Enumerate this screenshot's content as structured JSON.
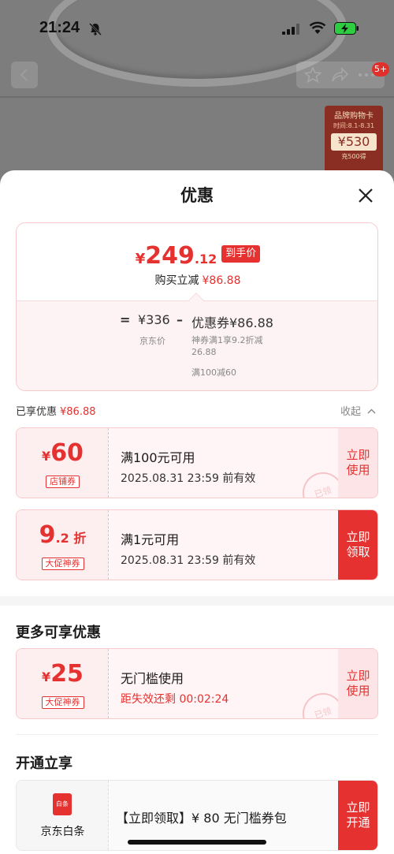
{
  "status_bar": {
    "time": "21:24"
  },
  "background": {
    "message_badge": "5+",
    "brand_card": {
      "title": "品牌购物卡",
      "time": "时间:8.1-8.31",
      "amount": "¥530",
      "condition": "充500得"
    }
  },
  "sheet": {
    "title": "优惠",
    "summary": {
      "price_yen": "¥",
      "price_int": "249",
      "price_dec": ".12",
      "price_tag": "到手价",
      "saving_label": "购买立减",
      "saving_amount": "¥86.88",
      "formula": {
        "eq": "=",
        "jd_price": "¥336",
        "minus": "–",
        "coupon_total": "优惠券¥86.88",
        "jd_label": "京东价",
        "coupon_detail1": "神券满1享9.2折减26.88",
        "coupon_detail2": "满100减60"
      }
    },
    "enjoyed": {
      "label": "已享优惠",
      "amount": "¥86.88",
      "collapse": "收起"
    },
    "coupons": [
      {
        "yen": "¥",
        "big": "60",
        "small": "",
        "type": "店铺券",
        "condition": "满100元可用",
        "validity": "2025.08.31 23:59 前有效",
        "stamp": "已领",
        "action_line1": "立即",
        "action_line2": "使用"
      },
      {
        "yen": "",
        "big": "9",
        "small": ".2 折",
        "type": "大促神券",
        "condition": "满1元可用",
        "validity": "2025.08.31 23:59 前有效",
        "action_line1": "立即",
        "action_line2": "领取"
      }
    ],
    "more_section": {
      "title": "更多可享优惠",
      "coupon": {
        "yen": "¥",
        "big": "25",
        "type": "大促神券",
        "condition": "无门槛使用",
        "countdown": "距失效还剩 00:02:24",
        "stamp": "已领",
        "action_line1": "立即",
        "action_line2": "使用"
      }
    },
    "open_section": {
      "title": "开通立享",
      "card": {
        "logo_text": "白条",
        "name": "京东白条",
        "text": "【立即领取】¥ 80 无门槛券包",
        "action_line1": "立即",
        "action_line2": "开通"
      }
    }
  },
  "colors": {
    "accent": "#e5312f",
    "coupon_bg": "#fdeeef",
    "card_border": "#f6c9cc"
  }
}
